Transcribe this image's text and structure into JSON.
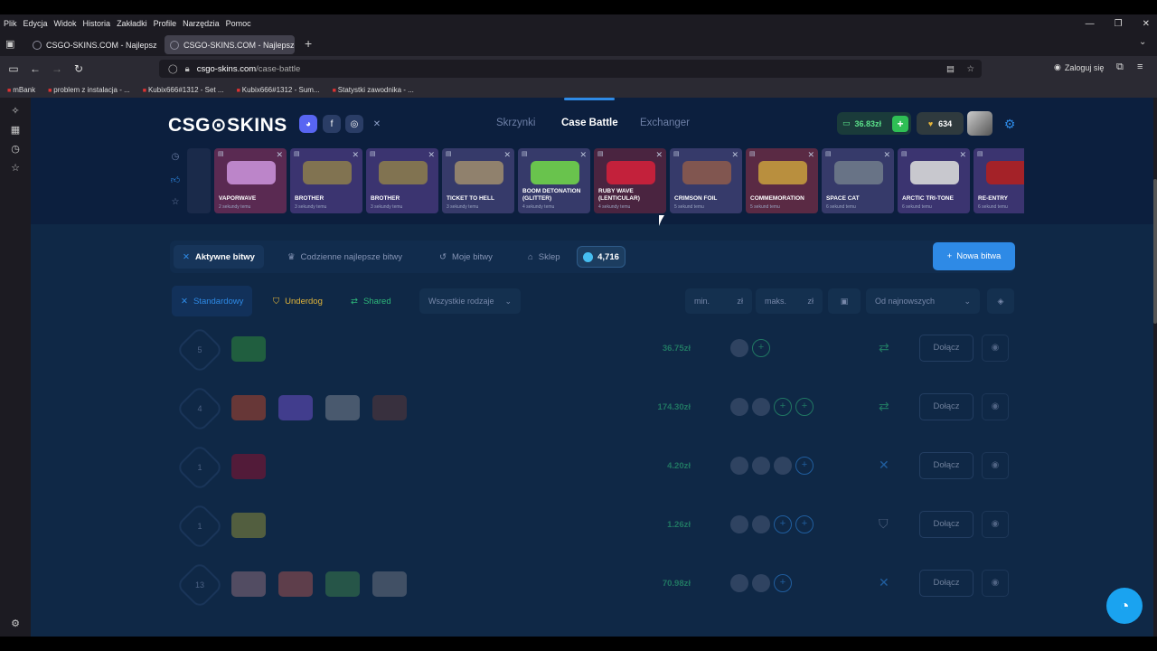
{
  "browser": {
    "menu": [
      "Plik",
      "Edycja",
      "Widok",
      "Historia",
      "Zakładki",
      "Profile",
      "Narzędzia",
      "Pomoc"
    ],
    "tabs": [
      {
        "title": "CSGO-SKINS.COM - Najlepsze ..."
      },
      {
        "title": "CSGO-SKINS.COM - Najlepsze ..."
      }
    ],
    "url_host": "csgo-skins.com",
    "url_path": "/case-battle",
    "login": "Zaloguj się",
    "bookmarks": [
      "mBank",
      "problem z instalacja - ...",
      "Kubix666#1312 - Set ...",
      "Kubix666#1312 - Sum...",
      "Statystki zawodnika - ..."
    ]
  },
  "site": {
    "logo": "CSG⊙SKINS",
    "nav": [
      {
        "label": "Skrzynki"
      },
      {
        "label": "Case Battle"
      },
      {
        "label": "Exchanger"
      }
    ],
    "balance": "36.83zł",
    "coins": "634",
    "colors": {
      "accent": "#2e8ae6",
      "green": "#2eb87a",
      "bg": "#0f2846"
    }
  },
  "drops": [
    {
      "name": "VAPORWAVE",
      "sub": "2 sekundy temu",
      "bg": "#5a2a52",
      "wpn": "#c78fd6"
    },
    {
      "name": "BROTHER",
      "sub": "3 sekundy temu",
      "bg": "#3b3470",
      "wpn": "#8a7a4e"
    },
    {
      "name": "BROTHER",
      "sub": "3 sekundy temu",
      "bg": "#3b3470",
      "wpn": "#8a7a4e"
    },
    {
      "name": "TICKET TO HELL",
      "sub": "3 sekundy temu",
      "bg": "#363a6a",
      "wpn": "#9a8a6e"
    },
    {
      "name": "BOOM DETONATION (GLITTER)",
      "sub": "4 sekundy temu",
      "bg": "#363a6a",
      "wpn": "#6fd34a"
    },
    {
      "name": "RUBY WAVE (LENTICULAR)",
      "sub": "4 sekundy temu",
      "bg": "#4a2440",
      "wpn": "#d0213b"
    },
    {
      "name": "CRIMSON FOIL",
      "sub": "5 sekund temu",
      "bg": "#363a6a",
      "wpn": "#8a5a4e"
    },
    {
      "name": "COMMEMORATION",
      "sub": "5 sekund temu",
      "bg": "#5a2a44",
      "wpn": "#c39a3e"
    },
    {
      "name": "SPACE CAT",
      "sub": "6 sekund temu",
      "bg": "#363a6a",
      "wpn": "#6e7a8a"
    },
    {
      "name": "ARCTIC TRI-TONE",
      "sub": "6 sekund temu",
      "bg": "#3b3470",
      "wpn": "#d8d8d8"
    },
    {
      "name": "RE-ENTRY",
      "sub": "6 sekund temu",
      "bg": "#3b3470",
      "wpn": "#b02020"
    }
  ],
  "tabs": [
    {
      "label": "Aktywne bitwy"
    },
    {
      "label": "Codzienne najlepsze bitwy"
    },
    {
      "label": "Moje bitwy"
    },
    {
      "label": "Sklep"
    }
  ],
  "gems": "4,716",
  "new_battle": "Nowa bitwa",
  "modes": [
    {
      "label": "Standardowy",
      "color": "#2e8ae6"
    },
    {
      "label": "Underdog",
      "color": "#e2b53a"
    },
    {
      "label": "Shared",
      "color": "#2eb87a"
    }
  ],
  "type_select": "Wszystkie rodzaje",
  "min_placeholder": "min.",
  "max_placeholder": "maks.",
  "currency": "zł",
  "sort_select": "Od najnowszych",
  "join_label": "Dołącz",
  "battles": [
    {
      "rounds": "5",
      "price": "36.75zł",
      "cases": [
        "#2f8a3a"
      ],
      "players": 1,
      "open": 1,
      "mode": "shared"
    },
    {
      "rounds": "4",
      "price": "174.30zł",
      "cases": [
        "#b0452b",
        "#6b4fc7",
        "#7a8290",
        "#5a3838"
      ],
      "players": 2,
      "open": 2,
      "mode": "shared"
    },
    {
      "rounds": "1",
      "price": "4.20zł",
      "cases": [
        "#8a1030"
      ],
      "players": 3,
      "open": 1,
      "mode": "standard"
    },
    {
      "rounds": "1",
      "price": "1.26zł",
      "cases": [
        "#8a8a3a"
      ],
      "players": 2,
      "open": 2,
      "mode": "underdog"
    },
    {
      "rounds": "13",
      "price": "70.98zł",
      "cases": [
        "#8a6a7a",
        "#a05050",
        "#3a7a4a",
        "#6a7280"
      ],
      "players": 2,
      "open": 1,
      "mode": "standard"
    }
  ]
}
